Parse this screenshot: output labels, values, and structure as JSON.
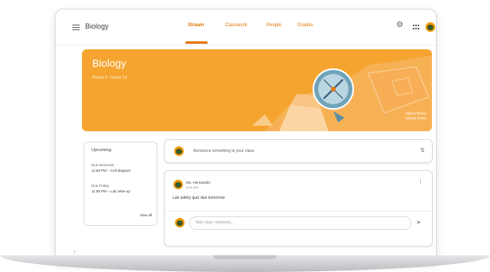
{
  "topbar": {
    "class_name": "Biology",
    "tabs": [
      "Stream",
      "Classwork",
      "People",
      "Grades"
    ],
    "active_tab": "Stream",
    "icons": [
      "menu-icon",
      "gear-icon",
      "apps-icon",
      "avatar"
    ]
  },
  "banner": {
    "title": "Biology",
    "subtitle": "Period 2 · Room 12",
    "link_line1": "Select theme",
    "link_line2": "Upload photo",
    "color": "#f5a52f"
  },
  "upcoming": {
    "title": "Upcoming",
    "item1_due": "Due tomorrow",
    "item1_title": "11:59 PM – Cell diagram",
    "item2_due": "Due Friday",
    "item2_title": "11:59 PM – Lab write-up",
    "view_all": "View all"
  },
  "announce": {
    "placeholder": "Announce something to your class",
    "icon": "repost-icon"
  },
  "post": {
    "author": "Ms. Hernandez",
    "date": "9:41 AM",
    "body": "Lab safety quiz due tomorrow",
    "comment_placeholder": "Add class comment..."
  },
  "colors": {
    "accent": "#e37400",
    "banner": "#f5a52f"
  }
}
